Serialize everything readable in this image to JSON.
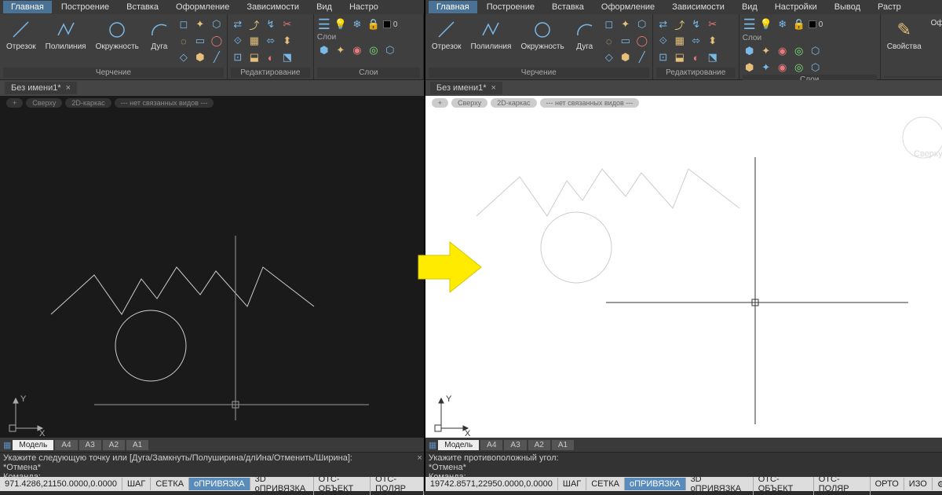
{
  "menu": {
    "tabs": [
      "Главная",
      "Построение",
      "Вставка",
      "Оформление",
      "Зависимости",
      "Вид",
      "Настро"
    ]
  },
  "menuR": {
    "tabs": [
      "Главная",
      "Построение",
      "Вставка",
      "Оформление",
      "Зависимости",
      "Вид",
      "Настройки",
      "Вывод",
      "Растр"
    ]
  },
  "ribbon": {
    "tools": {
      "t0": "Отрезок",
      "t1": "Полилиния",
      "t2": "Окружность",
      "t3": "Дуга"
    },
    "groups": {
      "draw": "Черчение",
      "edit": "Редактирование",
      "layers": "Слои",
      "props": "Свойства",
      "of": "Оф"
    },
    "layerlabel": "Слои"
  },
  "doc": {
    "name": "Без имени1*"
  },
  "viewpills": {
    "p0": "Сверху",
    "p1": "2D-каркас",
    "p2": "--- нет связанных видов ---"
  },
  "modeltabs": {
    "m0": "Модель",
    "m1": "A4",
    "m2": "A3",
    "m3": "A2",
    "m4": "A1"
  },
  "cmdL": {
    "l1": "Укажите следующую точку или [Дуга/Замкнуть/Полуширина/длИна/Отменить/Ширина]:",
    "l2": "*Отмена*",
    "l3": "Команда:"
  },
  "cmdR": {
    "l1": "Укажите противоположный угол:",
    "l2": "*Отмена*",
    "l3": "Команда:"
  },
  "statusL": {
    "coords": "971.4286,21150.0000,0.0000",
    "b0": "ШАГ",
    "b1": "СЕТКА",
    "b2": "оПРИВЯЗКА",
    "b3": "3D оПРИВЯЗКА",
    "b4": "ОТС-ОБЪЕКТ",
    "b5": "ОТС-ПОЛЯР"
  },
  "statusR": {
    "coords": "19742.8571,22950.0000,0.0000",
    "b0": "ШАГ",
    "b1": "СЕТКА",
    "b2": "оПРИВЯЗКА",
    "b3": "3D оПРИВЯЗКА",
    "b4": "ОТС-ОБЪЕКТ",
    "b5": "ОТС-ПОЛЯР",
    "b6": "ОРТО",
    "b7": "ИЗО"
  },
  "axis": {
    "x": "X",
    "y": "Y"
  }
}
